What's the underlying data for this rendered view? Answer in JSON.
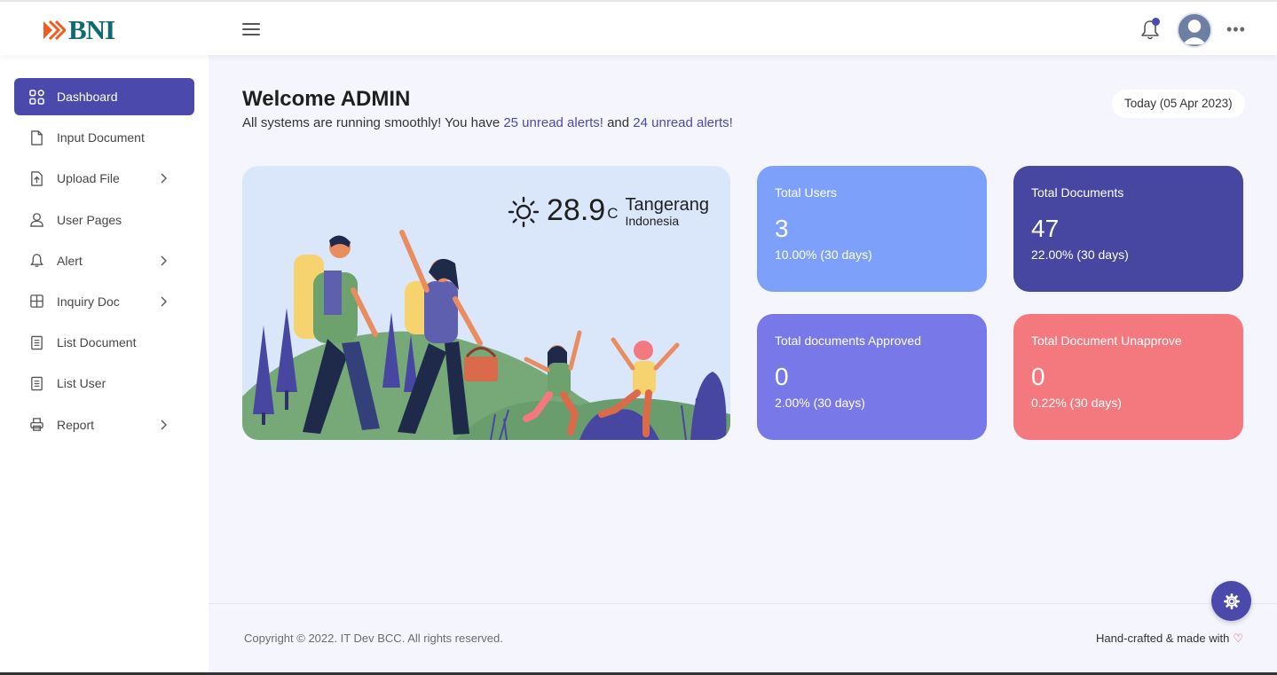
{
  "brand": {
    "name": "BNI",
    "color": "#0f6a74",
    "accent": "#f15a22"
  },
  "header": {
    "menu_icon": "hamburger-icon",
    "notification_icon": "bell-icon",
    "avatar_icon": "user-avatar",
    "more_icon": "more-horizontal-icon"
  },
  "sidebar": {
    "items": [
      {
        "label": "Dashboard",
        "icon": "grid-icon",
        "active": true,
        "has_submenu": false
      },
      {
        "label": "Input Document",
        "icon": "file-icon",
        "active": false,
        "has_submenu": false
      },
      {
        "label": "Upload File",
        "icon": "upload-icon",
        "active": false,
        "has_submenu": true
      },
      {
        "label": "User Pages",
        "icon": "user-icon",
        "active": false,
        "has_submenu": false
      },
      {
        "label": "Alert",
        "icon": "bell-icon",
        "active": false,
        "has_submenu": true
      },
      {
        "label": "Inquiry Doc",
        "icon": "table-icon",
        "active": false,
        "has_submenu": true
      },
      {
        "label": "List Document",
        "icon": "list-file-icon",
        "active": false,
        "has_submenu": false
      },
      {
        "label": "List User",
        "icon": "list-file-icon",
        "active": false,
        "has_submenu": false
      },
      {
        "label": "Report",
        "icon": "printer-icon",
        "active": false,
        "has_submenu": true
      }
    ]
  },
  "welcome": {
    "title": "Welcome ADMIN",
    "sub_prefix": "All systems are running smoothly! You have ",
    "link1": "25 unread alerts!",
    "sub_middle": " and ",
    "link2": "24 unread alerts!",
    "date": "Today (05 Apr 2023)"
  },
  "weather": {
    "icon": "sun-icon",
    "temperature": "28.9",
    "unit": "C",
    "city": "Tangerang",
    "country": "Indonesia"
  },
  "stats": [
    {
      "title": "Total Users",
      "value": "3",
      "sub": "10.00% (30 days)",
      "color": "#7da0fa"
    },
    {
      "title": "Total Documents",
      "value": "47",
      "sub": "22.00% (30 days)",
      "color": "#4747a1"
    },
    {
      "title": "Total documents Approved",
      "value": "0",
      "sub": "2.00% (30 days)",
      "color": "#7978e9"
    },
    {
      "title": "Total Document Unapprove",
      "value": "0",
      "sub": "0.22% (30 days)",
      "color": "#f3797e"
    }
  ],
  "footer": {
    "copyright": "Copyright © 2022. IT Dev BCC. All rights reserved.",
    "crafted": "Hand-crafted & made with",
    "heart": "♡",
    "settings_icon": "gear-icon"
  },
  "colors": {
    "primary": "#4b49ac",
    "background": "#f4f5fd"
  }
}
